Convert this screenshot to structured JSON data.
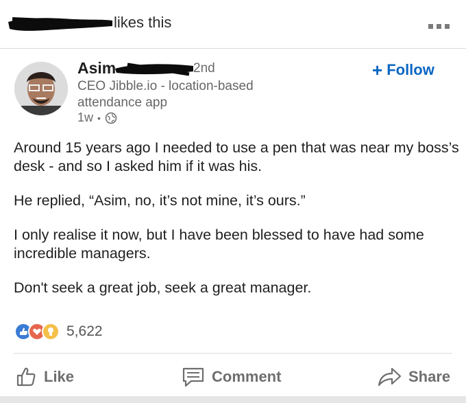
{
  "activity": {
    "text": "likes this"
  },
  "author": {
    "name": "Asim",
    "degree": "2nd",
    "headline": "CEO Jibble.io - location-based attendance app",
    "time": "1w",
    "separator": "•"
  },
  "follow": {
    "plus": "+",
    "label": "Follow"
  },
  "post": {
    "paragraphs": [
      "Around 15 years ago I needed to use a pen that was near my boss’s desk - and so I asked him if it was his.",
      "He replied, “Asim, no, it’s not mine, it’s ours.”",
      "I only realise it now, but I have been blessed to have had some incredible managers.",
      "Don't seek a great job, seek a great manager."
    ]
  },
  "reactions": {
    "count": "5,622",
    "types": [
      "like-icon",
      "love-icon",
      "insightful-icon"
    ]
  },
  "actions": {
    "like": "Like",
    "comment": "Comment",
    "share": "Share"
  },
  "colors": {
    "accent": "#0a66c2",
    "muted": "#6e6e6e"
  }
}
